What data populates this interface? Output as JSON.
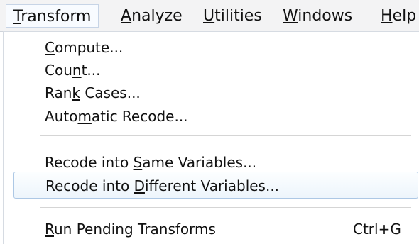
{
  "menubar": {
    "items": [
      {
        "pre": "",
        "mn": "T",
        "post": "ransform"
      },
      {
        "pre": "",
        "mn": "A",
        "post": "nalyze"
      },
      {
        "pre": "",
        "mn": "U",
        "post": "tilities"
      },
      {
        "pre": "",
        "mn": "W",
        "post": "indows"
      },
      {
        "pre": "",
        "mn": "H",
        "post": "elp"
      }
    ]
  },
  "menu": {
    "items": [
      {
        "pre": "",
        "mn": "C",
        "post": "ompute..."
      },
      {
        "pre": "Cou",
        "mn": "n",
        "post": "t..."
      },
      {
        "pre": "Ran",
        "mn": "k",
        "post": " Cases..."
      },
      {
        "pre": "Auto",
        "mn": "m",
        "post": "atic Recode..."
      },
      {
        "pre": "Recode into ",
        "mn": "S",
        "post": "ame Variables..."
      },
      {
        "pre": "Recode into ",
        "mn": "D",
        "post": "ifferent Variables..."
      },
      {
        "pre": "",
        "mn": "R",
        "post": "un Pending Transforms",
        "shortcut": "Ctrl+G"
      }
    ]
  }
}
